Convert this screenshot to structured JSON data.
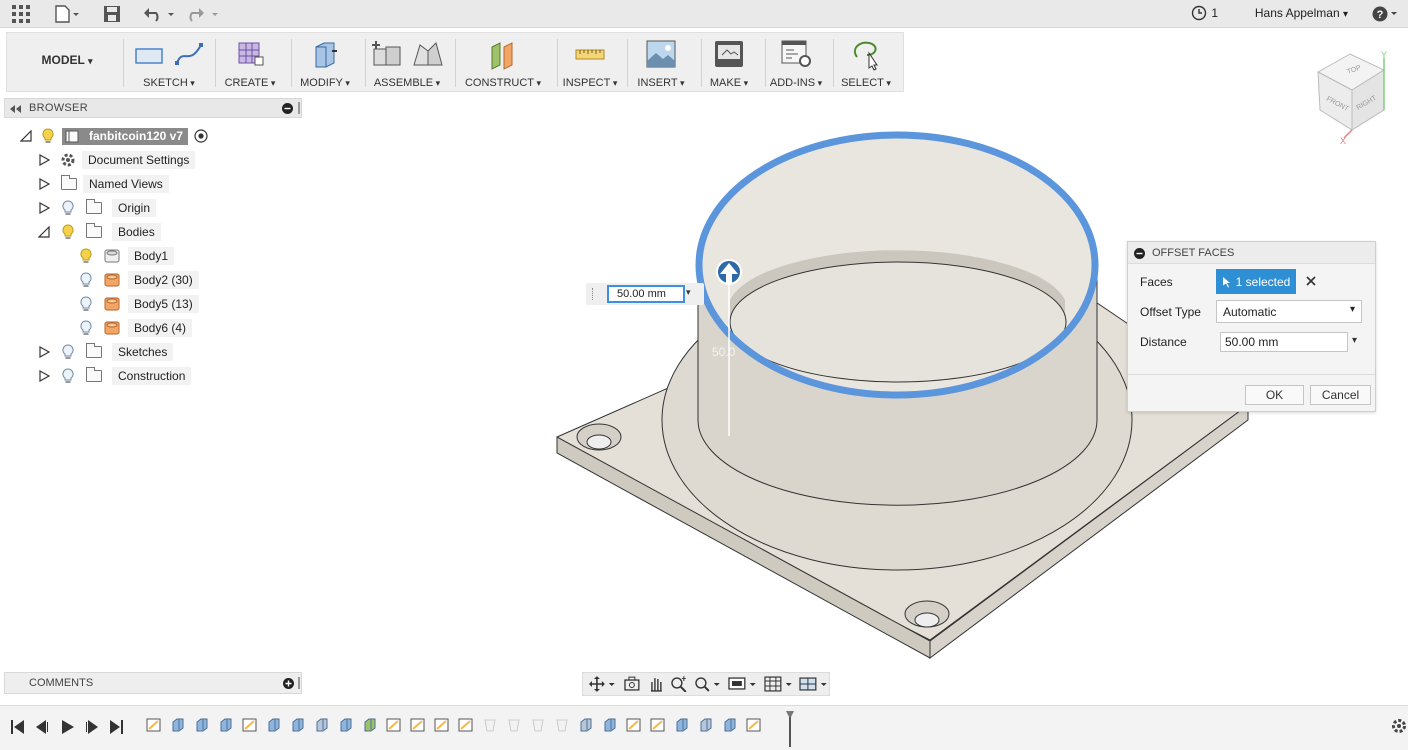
{
  "topbar": {
    "history_count": "1",
    "user_name": "Hans Appelman",
    "user_caret": "▾",
    "help_caret": "▾"
  },
  "toolbar": {
    "workspace": "MODEL",
    "groups": [
      {
        "label": "SKETCH"
      },
      {
        "label": "CREATE"
      },
      {
        "label": "MODIFY"
      },
      {
        "label": "ASSEMBLE"
      },
      {
        "label": "CONSTRUCT"
      },
      {
        "label": "INSPECT"
      },
      {
        "label": "INSERT"
      },
      {
        "label": "MAKE"
      },
      {
        "label": "ADD-INS"
      },
      {
        "label": "SELECT"
      }
    ]
  },
  "browser": {
    "title": "BROWSER",
    "root": "fanbitcoin120 v7",
    "items": [
      {
        "label": "Document Settings"
      },
      {
        "label": "Named Views"
      },
      {
        "label": "Origin"
      },
      {
        "label": "Bodies"
      },
      {
        "label": "Body1"
      },
      {
        "label": "Body2 (30)"
      },
      {
        "label": "Body5 (13)"
      },
      {
        "label": "Body6 (4)"
      },
      {
        "label": "Sketches"
      },
      {
        "label": "Construction"
      }
    ]
  },
  "comments": {
    "title": "COMMENTS"
  },
  "viewport": {
    "distance_input": "50.00 mm",
    "dimension_ghost": "50.0"
  },
  "dialog": {
    "title": "OFFSET FACES",
    "faces_label": "Faces",
    "faces_selection": "1 selected",
    "offset_type_label": "Offset Type",
    "offset_type_value": "Automatic",
    "distance_label": "Distance",
    "distance_value": "50.00 mm",
    "ok_label": "OK",
    "cancel_label": "Cancel"
  },
  "viewcube": {
    "top": "TOP",
    "front": "FRONT",
    "right": "RIGHT",
    "axis_x": "X",
    "axis_y": "Y"
  },
  "colors": {
    "accent": "#2e8fd5",
    "body_gray": "#dedad3",
    "selected_edge": "#5b95dc"
  }
}
